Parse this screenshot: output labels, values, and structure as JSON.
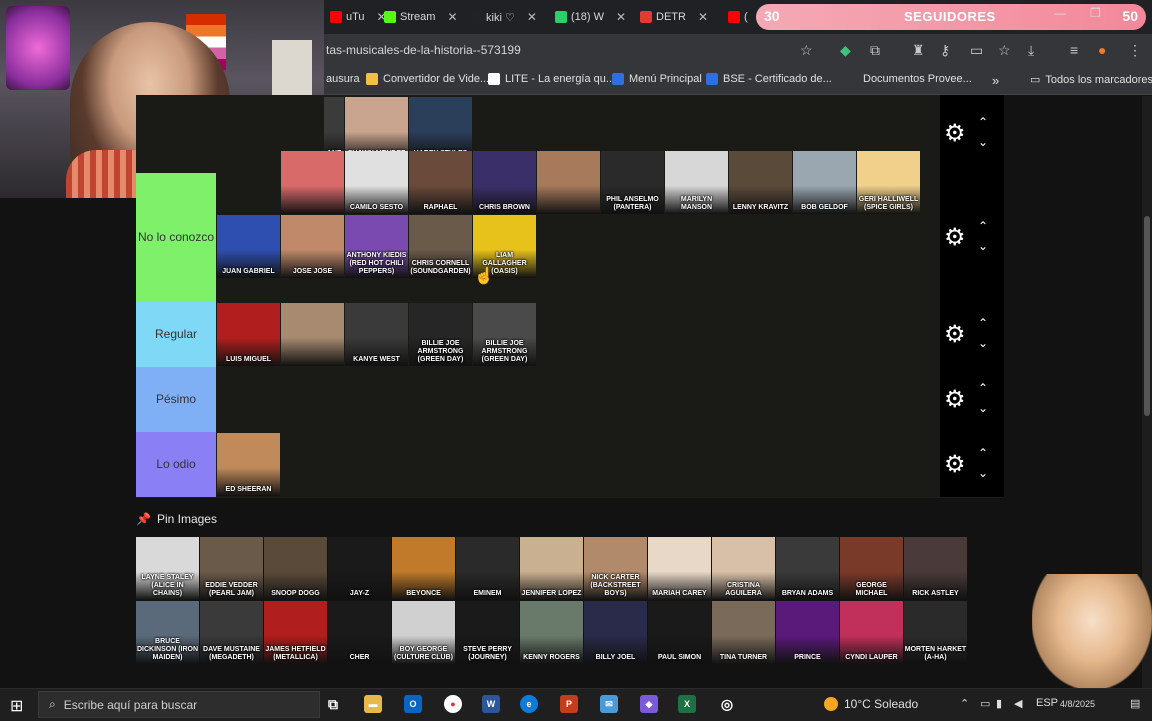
{
  "tabs": [
    {
      "label": "uTu",
      "favicon": "youtube-icon",
      "color": "#ff0000"
    },
    {
      "label": "Stream",
      "favicon": "kick-icon",
      "color": "#53fc18"
    },
    {
      "label": "kiki ♡",
      "favicon": "tiktok-icon",
      "color": "#222222"
    },
    {
      "label": "(18) W",
      "favicon": "whatsapp-icon",
      "color": "#25d366"
    },
    {
      "label": "DETR",
      "favicon": "tierlist-icon",
      "color": "#e03c31"
    },
    {
      "label": "(",
      "favicon": "youtube-icon",
      "color": "#ff0000"
    }
  ],
  "overlay": {
    "left_count": "30",
    "label": "SEGUIDORES",
    "right_count": "50"
  },
  "address": {
    "url": "tas-musicales-de-la-historia--573199"
  },
  "bookmarks": [
    {
      "label": "ausura",
      "color": "#f0b429"
    },
    {
      "label": "Convertidor de Vide...",
      "color": "#f0c040"
    },
    {
      "label": "LITE - La energía qu...",
      "color": "#ffffff"
    },
    {
      "label": "Menú Principal",
      "color": "#2f6fde"
    },
    {
      "label": "BSE - Certificado de...",
      "color": "#2f6fde"
    },
    {
      "label": "Documentos Provee...",
      "color": "#35363a"
    }
  ],
  "bookmarks_more": "»",
  "bookmarks_folder": "Todos los marcadores",
  "tiers": [
    {
      "label": "",
      "color": "#1a1a17",
      "items": [
        {
          "name": "ANZ",
          "bg": "#3b3b3b"
        },
        {
          "name": "SHAWN MENDEZ",
          "bg": "#c9a58f"
        },
        {
          "name": "HARRY STYLES",
          "bg": "#2b3e5a"
        }
      ]
    },
    {
      "label": "No lo conozco",
      "color": "#7ef06a",
      "items": [
        {
          "name": "",
          "bg": "#d86a6a"
        },
        {
          "name": "CAMILO SESTO",
          "bg": "#e0e0e0"
        },
        {
          "name": "RAPHAEL",
          "bg": "#6a4a3a"
        },
        {
          "name": "CHRIS BROWN",
          "bg": "#3b2f6a"
        },
        {
          "name": "",
          "bg": "#a67a5a"
        },
        {
          "name": "PHIL ANSELMO (PANTERA)",
          "bg": "#2a2a2a"
        },
        {
          "name": "MARILYN MANSON",
          "bg": "#d7d7d7"
        },
        {
          "name": "LENNY KRAVITZ",
          "bg": "#5a4a3a"
        },
        {
          "name": "BOB GELDOF",
          "bg": "#9aa7b0"
        },
        {
          "name": "GERI HALLIWELL (SPICE GIRLS)",
          "bg": "#f0d08a"
        },
        {
          "name": "JUAN GABRIEL",
          "bg": "#2f4fb0"
        },
        {
          "name": "JOSE JOSE",
          "bg": "#c08a6a"
        },
        {
          "name": "ANTHONY KIEDIS (RED HOT CHILI PEPPERS)",
          "bg": "#7a4ab0"
        },
        {
          "name": "CHRIS CORNELL (SOUNDGARDEN)",
          "bg": "#6a5a4a"
        },
        {
          "name": "LIAM GALLAGHER (OASIS)",
          "bg": "#e6c21a"
        }
      ]
    },
    {
      "label": "Regular",
      "color": "#7fd8f5",
      "items": [
        {
          "name": "LUIS MIGUEL",
          "bg": "#b01e1e"
        },
        {
          "name": "",
          "bg": "#a78a70"
        },
        {
          "name": "KANYE WEST",
          "bg": "#3a3a3a"
        },
        {
          "name": "BILLIE JOE ARMSTRONG (GREEN DAY)",
          "bg": "#262626"
        },
        {
          "name": "BILLIE JOE ARMSTRONG (GREEN DAY)",
          "bg": "#4a4a4a"
        }
      ]
    },
    {
      "label": "Pésimo",
      "color": "#7fb0f5",
      "items": []
    },
    {
      "label": "Lo odio",
      "color": "#8a7ff5",
      "items": [
        {
          "name": "ED SHEERAN",
          "bg": "#c08a5a"
        }
      ]
    }
  ],
  "pin": {
    "title": "Pin Images",
    "items": [
      {
        "name": "LAYNE STALEY (ALICE IN CHAINS)",
        "bg": "#d9d9d9"
      },
      {
        "name": "EDDIE VEDDER (PEARL JAM)",
        "bg": "#6a5a4a"
      },
      {
        "name": "SNOOP DOGG",
        "bg": "#5a4a3a"
      },
      {
        "name": "JAY-Z",
        "bg": "#1a1a1a"
      },
      {
        "name": "BEYONCE",
        "bg": "#c07a2a"
      },
      {
        "name": "EMINEM",
        "bg": "#2a2a2a"
      },
      {
        "name": "JENNIFER LOPEZ",
        "bg": "#c9b090"
      },
      {
        "name": "NICK CARTER (BACKSTREET BOYS)",
        "bg": "#b08a6a"
      },
      {
        "name": "MARIAH CAREY",
        "bg": "#e8d8c8"
      },
      {
        "name": "CRISTINA AGUILERA",
        "bg": "#d8c0a8"
      },
      {
        "name": "BRYAN ADAMS",
        "bg": "#3a3a3a"
      },
      {
        "name": "GEORGE MICHAEL",
        "bg": "#7a3a2a"
      },
      {
        "name": "RICK ASTLEY",
        "bg": "#4a3a3a"
      },
      {
        "name": "BRUCE DICKINSON (IRON MAIDEN)",
        "bg": "#5a6a7a"
      },
      {
        "name": "DAVE MUSTAINE (MEGADETH)",
        "bg": "#3a3a3a"
      },
      {
        "name": "JAMES HETFIELD (METALLICA)",
        "bg": "#b01e1e"
      },
      {
        "name": "CHER",
        "bg": "#1a1a1a"
      },
      {
        "name": "BOY GEORGE (CULTURE CLUB)",
        "bg": "#d0d0d0"
      },
      {
        "name": "STEVE PERRY (JOURNEY)",
        "bg": "#1a1a1a"
      },
      {
        "name": "KENNY ROGERS",
        "bg": "#6a7a6a"
      },
      {
        "name": "BILLY JOEL",
        "bg": "#2a2a4a"
      },
      {
        "name": "PAUL SIMON",
        "bg": "#1a1a1a"
      },
      {
        "name": "TINA TURNER",
        "bg": "#7a6a5a"
      },
      {
        "name": "PRINCE",
        "bg": "#5a1a7a"
      },
      {
        "name": "CYNDI LAUPER",
        "bg": "#c0305a"
      },
      {
        "name": "MORTEN HARKET (A-HA)",
        "bg": "#2a2a2a"
      }
    ]
  },
  "taskbar": {
    "search_placeholder": "Escribe aquí para buscar",
    "weather": "10°C  Soleado",
    "lang": "ESP",
    "date": "4/8/2025"
  }
}
